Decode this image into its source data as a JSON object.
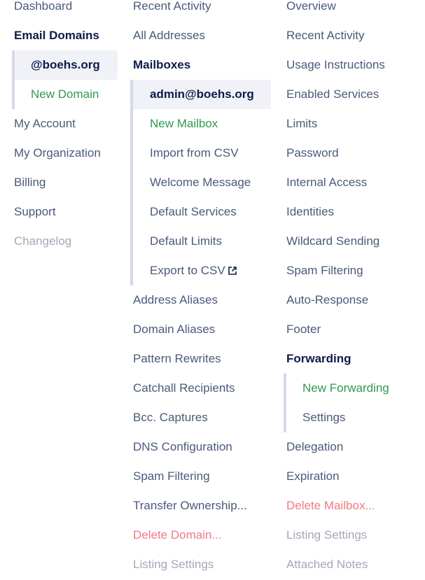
{
  "col1": {
    "dashboard": "Dashboard",
    "email_domains": "Email Domains",
    "domain_selected": "@boehs.org",
    "new_domain": "New Domain",
    "my_account": "My Account",
    "my_organization": "My Organization",
    "billing": "Billing",
    "support": "Support",
    "changelog": "Changelog"
  },
  "col2": {
    "recent_activity": "Recent Activity",
    "all_addresses": "All Addresses",
    "mailboxes": "Mailboxes",
    "mailbox_selected": "admin@boehs.org",
    "new_mailbox": "New Mailbox",
    "import_csv": "Import from CSV",
    "welcome_message": "Welcome Message",
    "default_services": "Default Services",
    "default_limits": "Default Limits",
    "export_csv": "Export to CSV",
    "address_aliases": "Address Aliases",
    "domain_aliases": "Domain Aliases",
    "pattern_rewrites": "Pattern Rewrites",
    "catchall": "Catchall Recipients",
    "bcc": "Bcc. Captures",
    "dns": "DNS Configuration",
    "spam": "Spam Filtering",
    "transfer": "Transfer Ownership...",
    "delete_domain": "Delete Domain...",
    "listing_settings": "Listing Settings"
  },
  "col3": {
    "overview": "Overview",
    "recent_activity": "Recent Activity",
    "usage": "Usage Instructions",
    "enabled_services": "Enabled Services",
    "limits": "Limits",
    "password": "Password",
    "internal_access": "Internal Access",
    "identities": "Identities",
    "wildcard": "Wildcard Sending",
    "spam": "Spam Filtering",
    "auto_response": "Auto-Response",
    "footer": "Footer",
    "forwarding": "Forwarding",
    "new_forwarding": "New Forwarding",
    "settings": "Settings",
    "delegation": "Delegation",
    "expiration": "Expiration",
    "delete_mailbox": "Delete Mailbox...",
    "listing_settings": "Listing Settings",
    "attached_notes": "Attached Notes"
  },
  "colors": {
    "text": "#4b5a7a",
    "heading": "#0d1b4a",
    "green": "#2f9a4f",
    "red": "#f07a84",
    "muted": "#a2a9b7",
    "selected_bg": "#f1f2f7",
    "rail": "#d6d9e6"
  },
  "icons": {
    "export": "external-link-icon"
  }
}
